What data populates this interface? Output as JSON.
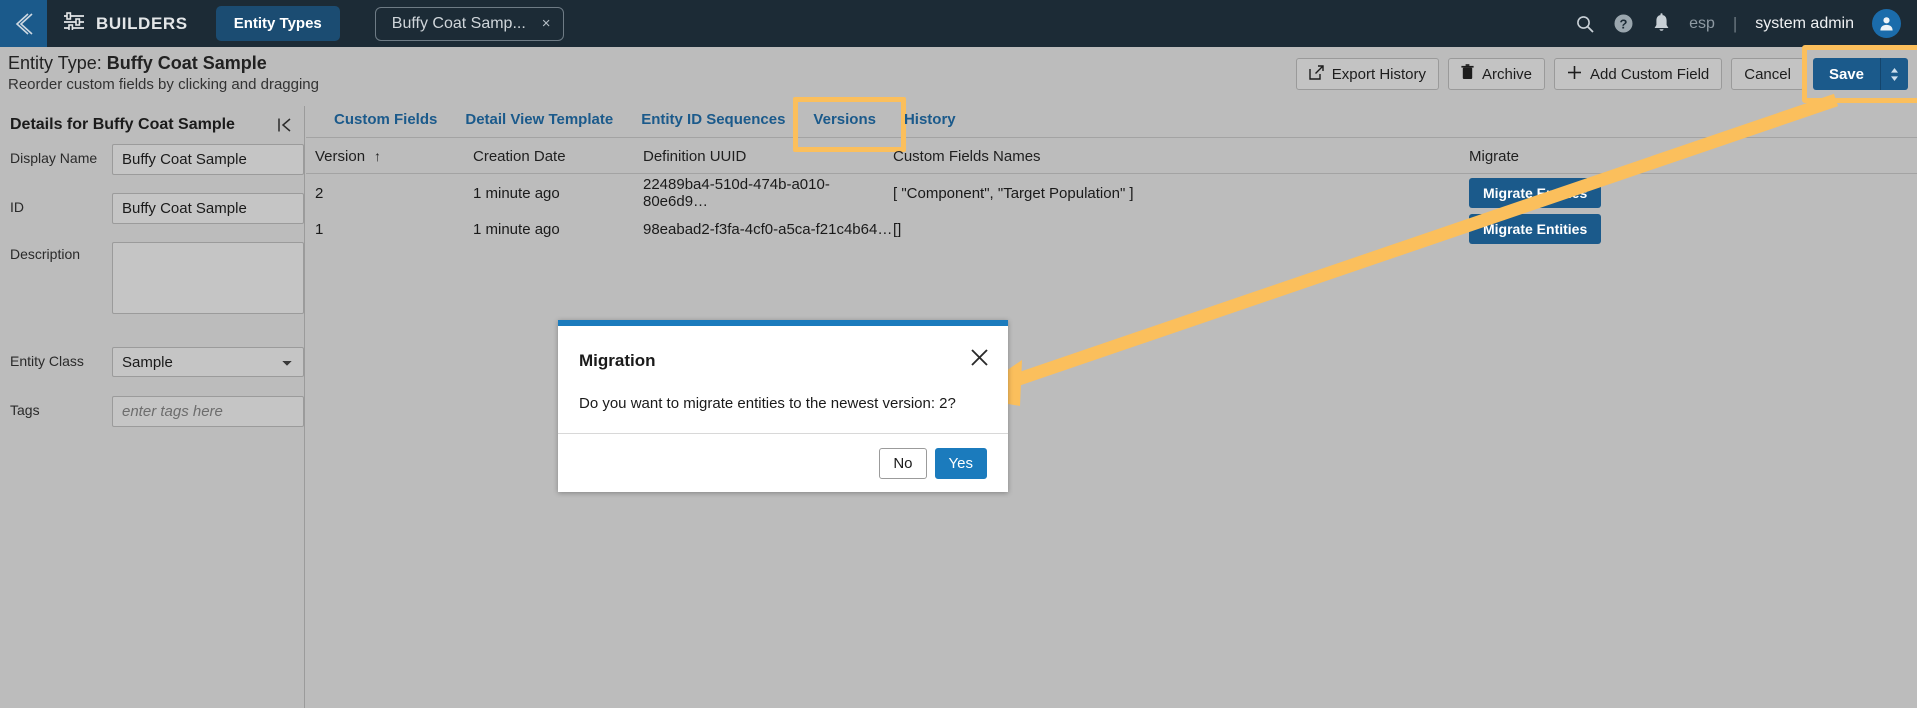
{
  "topnav": {
    "collapse_icon": "chevron-left-icon",
    "builders_icon": "sliders-icon",
    "builders_label": "BUILDERS",
    "entity_types_label": "Entity Types",
    "open_tab_label": "Buffy Coat Samp...",
    "open_tab_close": "×",
    "search_icon": "search-icon",
    "help_icon": "help-icon",
    "notifications_icon": "bell-icon",
    "language": "esp",
    "separator": "|",
    "user": "system admin",
    "avatar_icon": "user-avatar-icon"
  },
  "header": {
    "title_prefix": "Entity Type: ",
    "title_name": "Buffy Coat Sample",
    "subtitle": "Reorder custom fields by clicking and dragging",
    "actions": {
      "export_history": "Export History",
      "export_history_icon": "external-link-icon",
      "archive": "Archive",
      "archive_icon": "trash-icon",
      "add_custom_field": "Add Custom Field",
      "add_custom_field_icon": "plus-icon",
      "cancel": "Cancel",
      "save": "Save",
      "save_dropdown_icon": "updown-caret-icon"
    },
    "highlight_color": "#fbbf5c"
  },
  "details_panel": {
    "title": "Details for Buffy Coat Sample",
    "collapse_icon": "collapse-panel-icon",
    "fields": [
      {
        "label": "Display Name",
        "value": "Buffy Coat Sample",
        "placeholder": ""
      },
      {
        "label": "ID",
        "value": "Buffy Coat Sample",
        "placeholder": ""
      },
      {
        "label": "Description",
        "value": "",
        "placeholder": ""
      },
      {
        "label": "Entity Class",
        "value": "Sample",
        "placeholder": ""
      },
      {
        "label": "Tags",
        "value": "",
        "placeholder": "enter tags here"
      }
    ]
  },
  "tabs": [
    {
      "label": "Custom Fields",
      "active": false,
      "highlighted": false
    },
    {
      "label": "Detail View Template",
      "active": false,
      "highlighted": false
    },
    {
      "label": "Entity ID Sequences",
      "active": false,
      "highlighted": false
    },
    {
      "label": "Versions",
      "active": true,
      "highlighted": true
    },
    {
      "label": "History",
      "active": false,
      "highlighted": false
    }
  ],
  "versions_table": {
    "columns": [
      "Version",
      "Creation Date",
      "Definition UUID",
      "Custom Fields Names",
      "Migrate"
    ],
    "sort_column": "Version",
    "sort_arrow": "↑",
    "rows": [
      {
        "version": "2",
        "creation_date": "1 minute ago",
        "definition_uuid": "22489ba4-510d-474b-a010-80e6d9…",
        "custom_fields_names": "[ \"Component\", \"Target Population\" ]",
        "migrate_label": "Migrate Entities"
      },
      {
        "version": "1",
        "creation_date": "1 minute ago",
        "definition_uuid": "98eabad2-f3fa-4cf0-a5ca-f21c4b64…",
        "custom_fields_names": "[]",
        "migrate_label": "Migrate Entities"
      }
    ]
  },
  "modal": {
    "title": "Migration",
    "close_icon": "close-icon",
    "body": "Do you want to migrate entities to the newest version: 2?",
    "no_label": "No",
    "yes_label": "Yes"
  },
  "colors": {
    "nav_bg": "#1c2b36",
    "accent_blue": "#1b5a8b",
    "link_blue": "#1b5a8b",
    "primary_blue": "#1b7bbd",
    "page_bg": "#bcbcbc",
    "annotation_orange": "#fbbf5c"
  }
}
